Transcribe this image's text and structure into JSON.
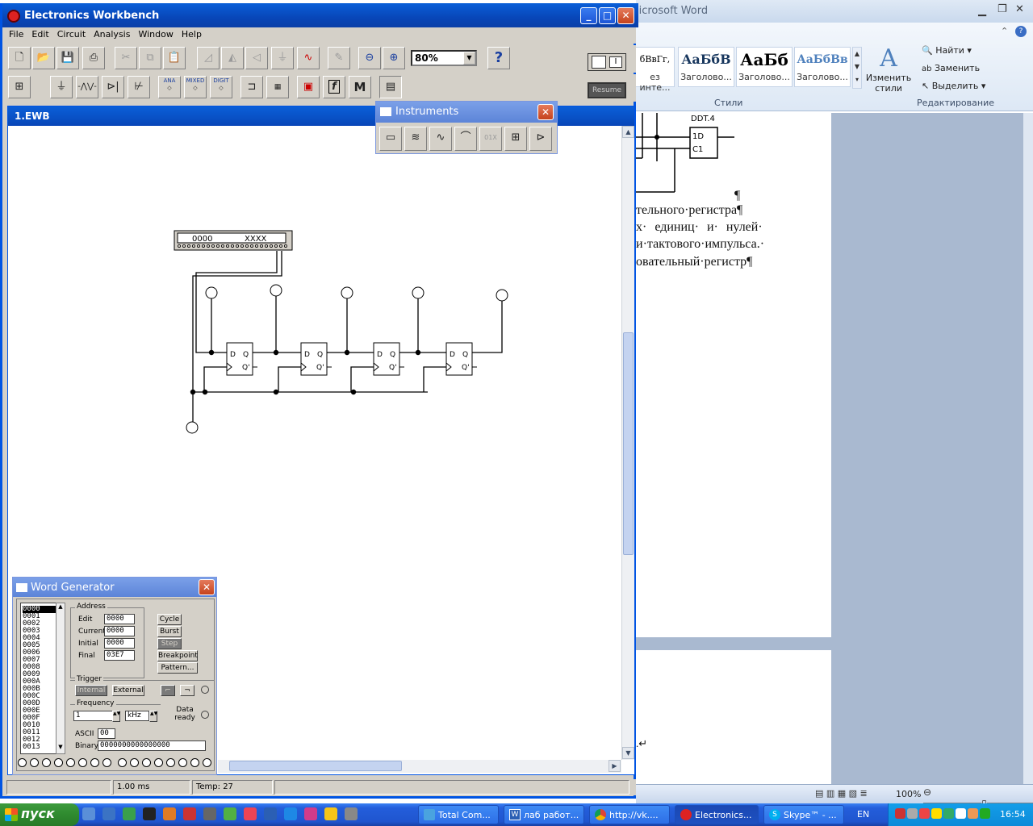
{
  "word": {
    "title": "licrosoft Word",
    "styles": [
      {
        "sample": "бВвГг,",
        "label": "ез инте..."
      },
      {
        "sample": "АаБбВ",
        "label": "Заголово..."
      },
      {
        "sample": "АаБб",
        "label": "Заголово..."
      },
      {
        "sample": "АаБбВв",
        "label": "Заголово..."
      }
    ],
    "change_styles": "Изменить стили",
    "group_styles": "Стили",
    "find": "Найти",
    "replace": "Заменить",
    "select": "Выделить",
    "group_editing": "Редактирование",
    "doc_lines": [
      "тельного·регистра¶",
      "х· единиц· и· нулей·",
      "и·тактового·импульса.·",
      "овательный·регистр¶"
    ],
    "pilcrow": "¶",
    "fig_label": "DDT.4",
    "fig_pin1": "1D",
    "fig_pin2": "C1",
    "enter_mark": ".↵",
    "zoom": "100%"
  },
  "ewb": {
    "title": "Electronics Workbench",
    "menu": [
      "File",
      "Edit",
      "Circuit",
      "Analysis",
      "Window",
      "Help"
    ],
    "zoom_value": "80%",
    "help_label": "?",
    "resume_label": "Resume",
    "power_label": "I",
    "comp_labels": [
      "ANA",
      "MIXED",
      "DIGIT"
    ],
    "m_label": "M",
    "f_label": "f",
    "circuit_title": "1.EWB",
    "display_left": "0000",
    "display_right": "XXXX",
    "ff_pins": [
      "D",
      "Q",
      "Q'"
    ],
    "status": [
      "1.00 ms",
      "Temp:  27"
    ]
  },
  "instruments": {
    "title": "Instruments"
  },
  "word_generator": {
    "title": "Word Generator",
    "list": [
      "0000",
      "0001",
      "0002",
      "0003",
      "0004",
      "0005",
      "0006",
      "0007",
      "0008",
      "0009",
      "000A",
      "000B",
      "000C",
      "000D",
      "000E",
      "000F",
      "0010",
      "0011",
      "0012",
      "0013"
    ],
    "address_label": "Address",
    "edit_label": "Edit",
    "edit_value": "0000",
    "current_label": "Current",
    "current_value": "0000",
    "initial_label": "Initial",
    "initial_value": "0000",
    "final_label": "Final",
    "final_value": "03E7",
    "cycle": "Cycle",
    "burst": "Burst",
    "step": "Step",
    "breakpoint": "Breakpoint",
    "pattern": "Pattern...",
    "trigger_label": "Trigger",
    "internal": "Internal",
    "external": "External",
    "frequency_label": "Frequency",
    "freq_value": "1",
    "freq_unit": "kHz",
    "data_ready": "Data ready",
    "ascii_label": "ASCII",
    "ascii_value": "00",
    "binary_label": "Binary",
    "binary_value": "0000000000000000"
  },
  "taskbar": {
    "start": "пуск",
    "tasks": [
      "Total Com...",
      "лаб работ...",
      "http://vk....",
      "Electronics...",
      "Skype™ - ..."
    ],
    "lang": "EN",
    "clock": "16:54"
  }
}
